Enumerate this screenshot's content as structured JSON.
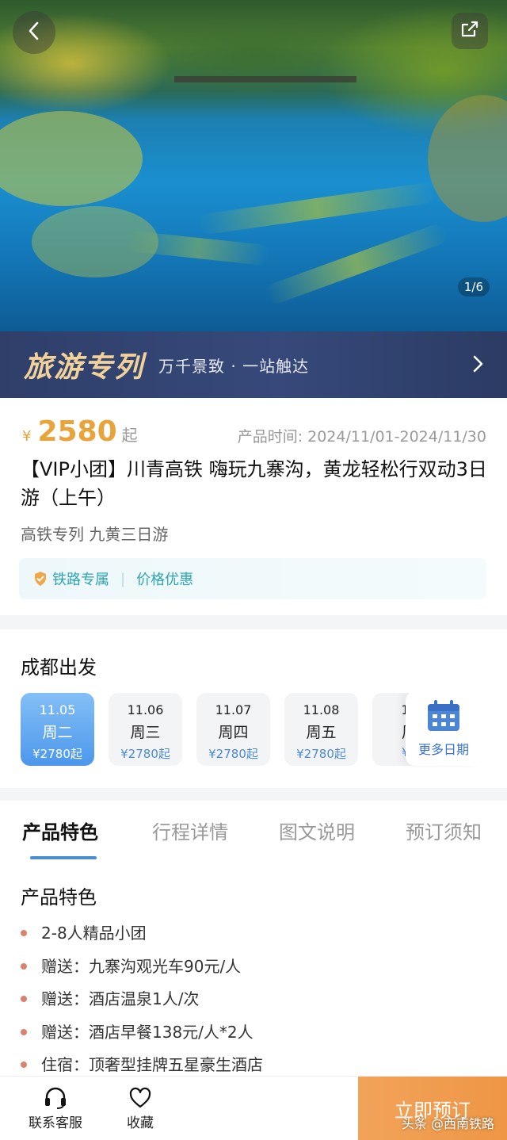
{
  "hero": {
    "counter": "1/6"
  },
  "banner": {
    "title": "旅游专列",
    "subtitle": "万千景致 · 一站触达"
  },
  "product": {
    "currency": "¥",
    "price": "2580",
    "price_suffix": "起",
    "time_label": "产品时间:",
    "time_value": "2024/11/01-2024/11/30",
    "title": "【VIP小团】川青高铁 嗨玩九寨沟，黄龙轻松行双动3日游（上午）",
    "subtitle": "高铁专列 九黄三日游",
    "tags": [
      "铁路专属",
      "价格优惠"
    ]
  },
  "departure": {
    "title": "成都出发",
    "dates": [
      {
        "date": "11.05",
        "weekday": "周二",
        "price": "¥2780起",
        "selected": true
      },
      {
        "date": "11.06",
        "weekday": "周三",
        "price": "¥2780起",
        "selected": false
      },
      {
        "date": "11.07",
        "weekday": "周四",
        "price": "¥2780起",
        "selected": false
      },
      {
        "date": "11.08",
        "weekday": "周五",
        "price": "¥2780起",
        "selected": false
      },
      {
        "date": "11",
        "weekday": "周",
        "price": "¥2",
        "selected": false
      }
    ],
    "more_label": "更多日期"
  },
  "tabs": [
    "产品特色",
    "行程详情",
    "图文说明",
    "预订须知"
  ],
  "features": {
    "title": "产品特色",
    "items": [
      "2-8人精品小团",
      "赠送：九寨沟观光车90元/人",
      "赠送：酒店温泉1人/次",
      "赠送：酒店早餐138元/人*2人",
      "住宿：顶奢型挂牌五星豪生酒店"
    ]
  },
  "bottom": {
    "service_label": "联系客服",
    "favorite_label": "收藏",
    "cta_label": "立即预订"
  },
  "watermark": "头条 @西南铁路",
  "colors": {
    "price": "#e8a43b",
    "accent_blue": "#4a8bd6",
    "cta": "#ee9645",
    "banner_bg": "#2f3f6a",
    "tag_text": "#2ea3b3"
  }
}
